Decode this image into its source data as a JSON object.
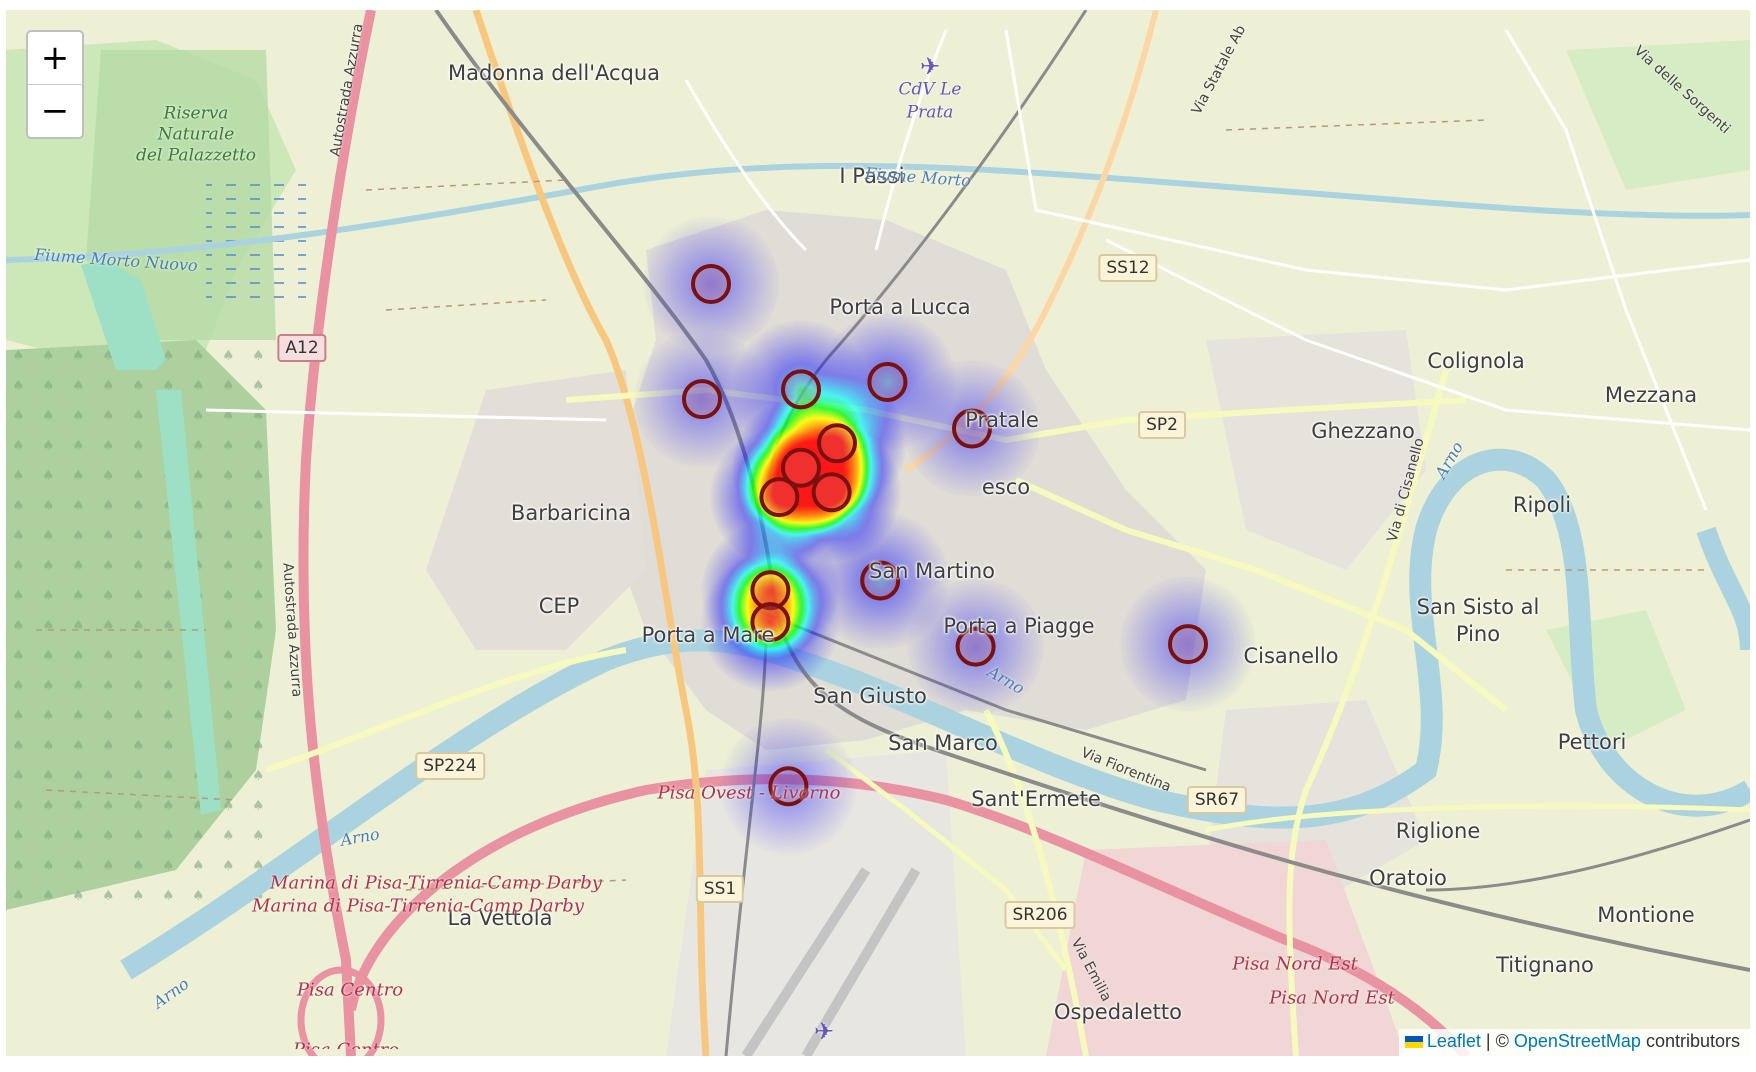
{
  "zoom": {
    "in_label": "+",
    "out_label": "−"
  },
  "attribution": {
    "leaflet_label": "Leaflet",
    "separator": "| ©",
    "osm_label": "OpenStreetMap",
    "suffix": "contributors"
  },
  "places": {
    "madonna": "Madonna dell'Acqua",
    "passi": "I Passi",
    "porta_lucca": "Porta a Lucca",
    "pratale": "Pratale",
    "barbaricina": "Barbaricina",
    "cep": "CEP",
    "porta_mare": "Porta a Mare",
    "san_martino": "San Martino",
    "porta_piagge": "Porta a Piagge",
    "san_giusto": "San Giusto",
    "san_marco": "San Marco",
    "santermete": "Sant'Ermete",
    "vettola": "La Vettola",
    "ospedaletto": "Ospedaletto",
    "colignola": "Colignola",
    "mezzana": "Mezzana",
    "ghezzano": "Ghezzano",
    "ripoli": "Ripoli",
    "san_sisto": "San Sisto al",
    "pino": "Pino",
    "cisanello": "Cisanello",
    "pettori": "Pettori",
    "riglione": "Riglione",
    "oratoio": "Oratoio",
    "montione": "Montione",
    "titignano": "Titignano",
    "fresco": "esco"
  },
  "water": {
    "fiume_morto_1": "Fiume Morto",
    "fiume_morto_2": "Fiume Morto Nuovo",
    "arno_1": "Arno",
    "arno_2": "Arno",
    "arno_3": "Arno",
    "arno_4": "Arno",
    "arno_5": "Arno"
  },
  "park": {
    "line1": "Riserva",
    "line2": "Naturale",
    "line3": "del Palazzetto"
  },
  "airport": {
    "line1": "CdV Le",
    "line2": "Prata"
  },
  "exits": {
    "pisa_ovest": "Pisa Ovest - Livorno",
    "marina1": "Marina di Pisa-Tirrenia-Camp Darby",
    "marina2": "Marina di Pisa-Tirrenia-Camp Darby",
    "pisa_centro": "Pisa Centro",
    "pisa_centro2": "Pisa Centro",
    "nord_est1": "Pisa Nord Est",
    "nord_est2": "Pisa Nord Est"
  },
  "road_names": {
    "autostrada1": "Autostrada Azzurra",
    "autostrada2": "Autostrada Azzurra",
    "via_statale": "Via Statale Ab",
    "via_sorgenti": "Via delle Sorgenti",
    "via_cisanello": "Via di Cisanello",
    "via_fiorentina": "Via Fiorentina",
    "via_emilia": "Via Emilia"
  },
  "shields": {
    "ss12": "SS12",
    "a12": "A12",
    "sp2": "SP2",
    "sp224": "SP224",
    "sr67": "SR67",
    "ss1": "SS1",
    "sr206": "SR206"
  },
  "heatmap": {
    "points": [
      {
        "lat": 43.7305,
        "lng": 10.396,
        "weight": 0.35
      },
      {
        "lat": 43.7258,
        "lng": 10.3955,
        "weight": 0.35
      },
      {
        "lat": 43.7262,
        "lng": 10.401,
        "weight": 0.55
      },
      {
        "lat": 43.7265,
        "lng": 10.4058,
        "weight": 0.45
      },
      {
        "lat": 43.7246,
        "lng": 10.4105,
        "weight": 0.35
      },
      {
        "lat": 43.724,
        "lng": 10.403,
        "weight": 0.8
      },
      {
        "lat": 43.723,
        "lng": 10.401,
        "weight": 1.0
      },
      {
        "lat": 43.722,
        "lng": 10.4027,
        "weight": 0.9
      },
      {
        "lat": 43.7218,
        "lng": 10.3998,
        "weight": 0.8
      },
      {
        "lat": 43.718,
        "lng": 10.3993,
        "weight": 0.75
      },
      {
        "lat": 43.7167,
        "lng": 10.3993,
        "weight": 0.75
      },
      {
        "lat": 43.7184,
        "lng": 10.4054,
        "weight": 0.45
      },
      {
        "lat": 43.7157,
        "lng": 10.4107,
        "weight": 0.35
      },
      {
        "lat": 43.7158,
        "lng": 10.4225,
        "weight": 0.35
      },
      {
        "lat": 43.71,
        "lng": 10.4003,
        "weight": 0.35
      }
    ],
    "gradient": {
      "0.4": "#0000ff",
      "0.6": "#00ffff",
      "0.7": "#00ff00",
      "0.8": "#ffff00",
      "1.0": "#ff0000"
    }
  },
  "markers": {
    "stroke": "#7a1010",
    "points": [
      {
        "lat": 43.7305,
        "lng": 10.396
      },
      {
        "lat": 43.7258,
        "lng": 10.3955
      },
      {
        "lat": 43.7262,
        "lng": 10.401
      },
      {
        "lat": 43.7265,
        "lng": 10.4058
      },
      {
        "lat": 43.7246,
        "lng": 10.4105
      },
      {
        "lat": 43.724,
        "lng": 10.403
      },
      {
        "lat": 43.723,
        "lng": 10.401
      },
      {
        "lat": 43.722,
        "lng": 10.4027
      },
      {
        "lat": 43.7218,
        "lng": 10.3998
      },
      {
        "lat": 43.718,
        "lng": 10.3993
      },
      {
        "lat": 43.7167,
        "lng": 10.3993
      },
      {
        "lat": 43.7184,
        "lng": 10.4054
      },
      {
        "lat": 43.7157,
        "lng": 10.4107
      },
      {
        "lat": 43.7158,
        "lng": 10.4225
      },
      {
        "lat": 43.71,
        "lng": 10.4003
      }
    ]
  }
}
